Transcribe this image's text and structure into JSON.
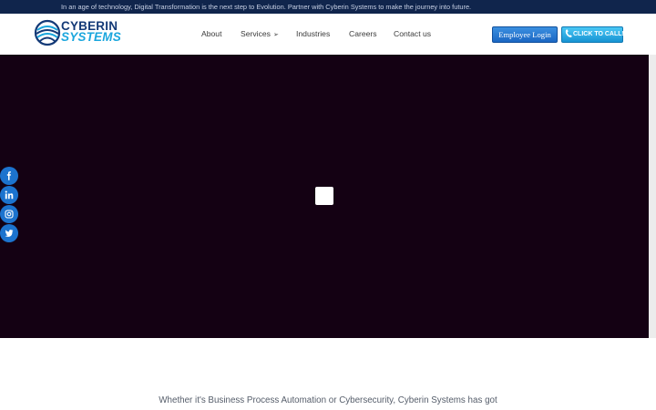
{
  "topbar": {
    "message": "In an age of technology, Digital Transformation is the next step to Evolution. Partner with Cyberin Systems to make the journey into future."
  },
  "logo": {
    "line1": "CYBERIN",
    "line2": "SYSTEMS"
  },
  "nav": {
    "items": [
      {
        "label": "About"
      },
      {
        "label": "Services",
        "has_submenu": true
      },
      {
        "label": "Industries"
      },
      {
        "label": "Careers"
      },
      {
        "label": "Contact us"
      }
    ],
    "submenu_arrow": "➢"
  },
  "actions": {
    "employee_login": "Employee Login",
    "click_to_call": "CLICK TO CALL!"
  },
  "social": {
    "icons": [
      "facebook-icon",
      "linkedin-icon",
      "instagram-icon",
      "twitter-icon"
    ]
  },
  "content": {
    "tagline": "Whether it's Business Process Automation or Cybersecurity, Cyberin Systems has got"
  },
  "colors": {
    "topbar_bg": "#10254c",
    "hero_bg": "#140113",
    "accent_blue": "#1c73ce",
    "logo_dark": "#143a77",
    "logo_light": "#1aa6dd"
  }
}
